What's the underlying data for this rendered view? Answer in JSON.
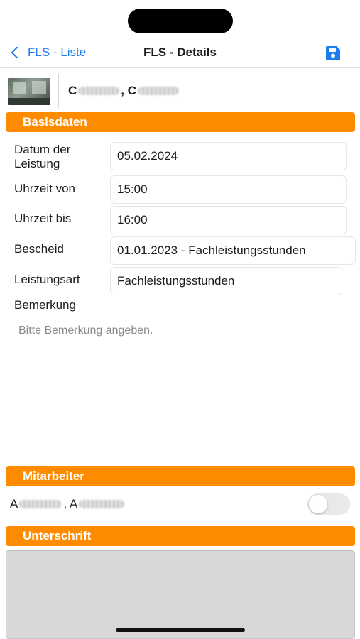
{
  "navbar": {
    "back_label": "FLS - Liste",
    "title": "FLS - Details",
    "save_icon": "floppy-disk-icon"
  },
  "person": {
    "name_first_initial": "C",
    "name_second_initial": ", C"
  },
  "sections": {
    "basisdaten": "Basisdaten",
    "mitarbeiter": "Mitarbeiter",
    "unterschrift": "Unterschrift"
  },
  "form": {
    "datum_label_line1": "Datum der",
    "datum_label_line2": "Leistung",
    "datum_value": "05.02.2024",
    "uhrzeit_von_label": "Uhrzeit von",
    "uhrzeit_von_value": "15:00",
    "uhrzeit_bis_label": "Uhrzeit bis",
    "uhrzeit_bis_value": "16:00",
    "bescheid_label": "Bescheid",
    "bescheid_value": "01.01.2023 - Fachleistungsstunden",
    "leistungsart_label": "Leistungsart",
    "leistungsart_value": "Fachleistungsstunden",
    "bemerkung_label": "Bemerkung",
    "bemerkung_placeholder": "Bitte Bemerkung angeben."
  },
  "staff": {
    "name_first_initial": "A",
    "name_second_initial": ", A",
    "toggle_on": false
  },
  "colors": {
    "accent": "#ff8c00",
    "link": "#1a7cf0"
  }
}
